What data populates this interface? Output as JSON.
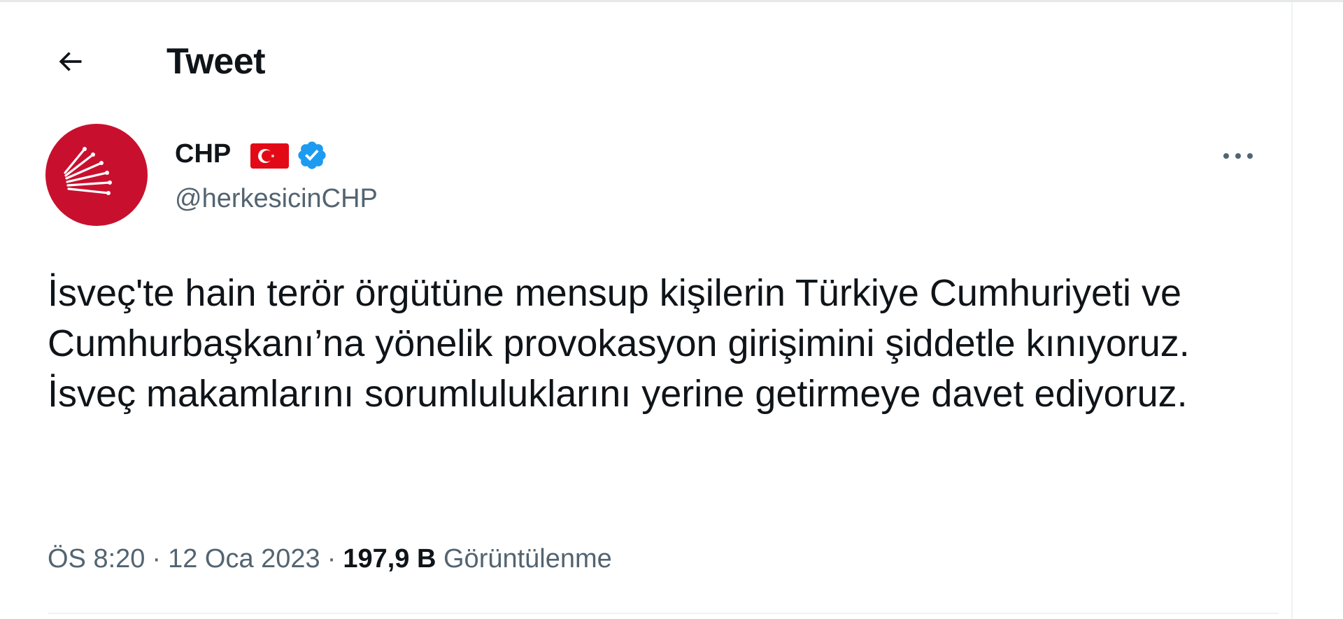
{
  "header": {
    "title": "Tweet",
    "back_icon": "arrow-left-icon"
  },
  "author": {
    "name": "CHP",
    "handle": "@herkesicinCHP",
    "avatar_icon": "six-arrows-logo",
    "flag_icon": "turkey-flag-icon",
    "verified_icon": "verified-badge-icon",
    "more_icon": "ellipsis-icon"
  },
  "tweet": {
    "text": "İsveç'te hain terör örgütüne mensup kişilerin Türkiye Cumhuriyeti ve Cumhurbaşkanı’na yönelik provokasyon girişimini şiddetle kınıyoruz. İsveç makamlarını sorumluluklarını yerine getirmeye davet ediyoruz.",
    "time": "ÖS 8:20",
    "separator": "·",
    "date": "12 Oca 2023",
    "views_count": "197,9 B",
    "views_label": "Görüntülenme"
  },
  "colors": {
    "text_primary": "#0f1419",
    "text_secondary": "#536471",
    "avatar_red": "#c8102e",
    "flag_red": "#e30a17",
    "verified_blue": "#1d9bf0",
    "divider": "#eff3f4"
  }
}
